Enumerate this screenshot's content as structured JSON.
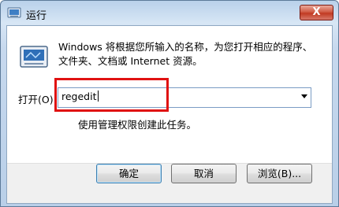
{
  "window": {
    "title": "运行",
    "close_label": "X"
  },
  "description": {
    "line1": "Windows 将根据您所输入的名称，为您打开相应的程序、",
    "line2": "文件夹、文档或 Internet 资源。"
  },
  "open": {
    "label": "打开(O):",
    "value": "regedit"
  },
  "hint": "使用管理权限创建此任务。",
  "buttons": {
    "ok": "确定",
    "cancel": "取消",
    "browse": "浏览(B)..."
  },
  "colors": {
    "highlight": "#e01111",
    "titlebar": "#b9d1ea",
    "close": "#c13a22"
  }
}
